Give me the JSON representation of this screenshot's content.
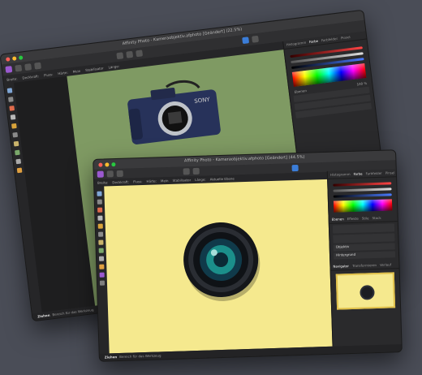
{
  "back_window": {
    "title": "Affinity Photo - Kameraobjektiv.afphoto [Geändert] (22.5%)",
    "context_labels": [
      "Breite:",
      "Deckkraft:",
      "Fluss:",
      "Härte:",
      "Mein",
      "Stabilisator",
      "Länge:"
    ],
    "panel_tabs": [
      "Histogramm",
      "Farbe",
      "Farbfelder",
      "Pinsel"
    ],
    "panel_section": "Ebenen",
    "panel_percent": "100 %",
    "status": {
      "label": "Ziehen",
      "text": "Bereich für das Werkzeug"
    }
  },
  "front_window": {
    "title": "Affinity Photo - Kameraobjektiv.afphoto [Geändert] (44.5%)",
    "context_labels": [
      "Breite:",
      "Deckkraft:",
      "Fluss:",
      "Härte:",
      "Mein",
      "Stabilisator",
      "Länge:",
      "Aktuelle Ebene"
    ],
    "panel_tabs": [
      "Histogramm",
      "Farbe",
      "Farbfelder",
      "Pinsel"
    ],
    "layer_tabs": [
      "Ebenen",
      "Effekte",
      "Stile",
      "Stock"
    ],
    "layer_names": [
      "Objektiv",
      "Hintergrund"
    ],
    "navigator_tabs": [
      "Navigator",
      "Transformieren",
      "Verlauf"
    ],
    "status": {
      "label": "Ziehen",
      "text": "Bereich für das Werkzeug"
    }
  },
  "colors": {
    "desktop": "#4a4d57",
    "back_canvas": "#7f9a63",
    "front_canvas": "#f5e98e",
    "accent": "#9b59d0"
  }
}
